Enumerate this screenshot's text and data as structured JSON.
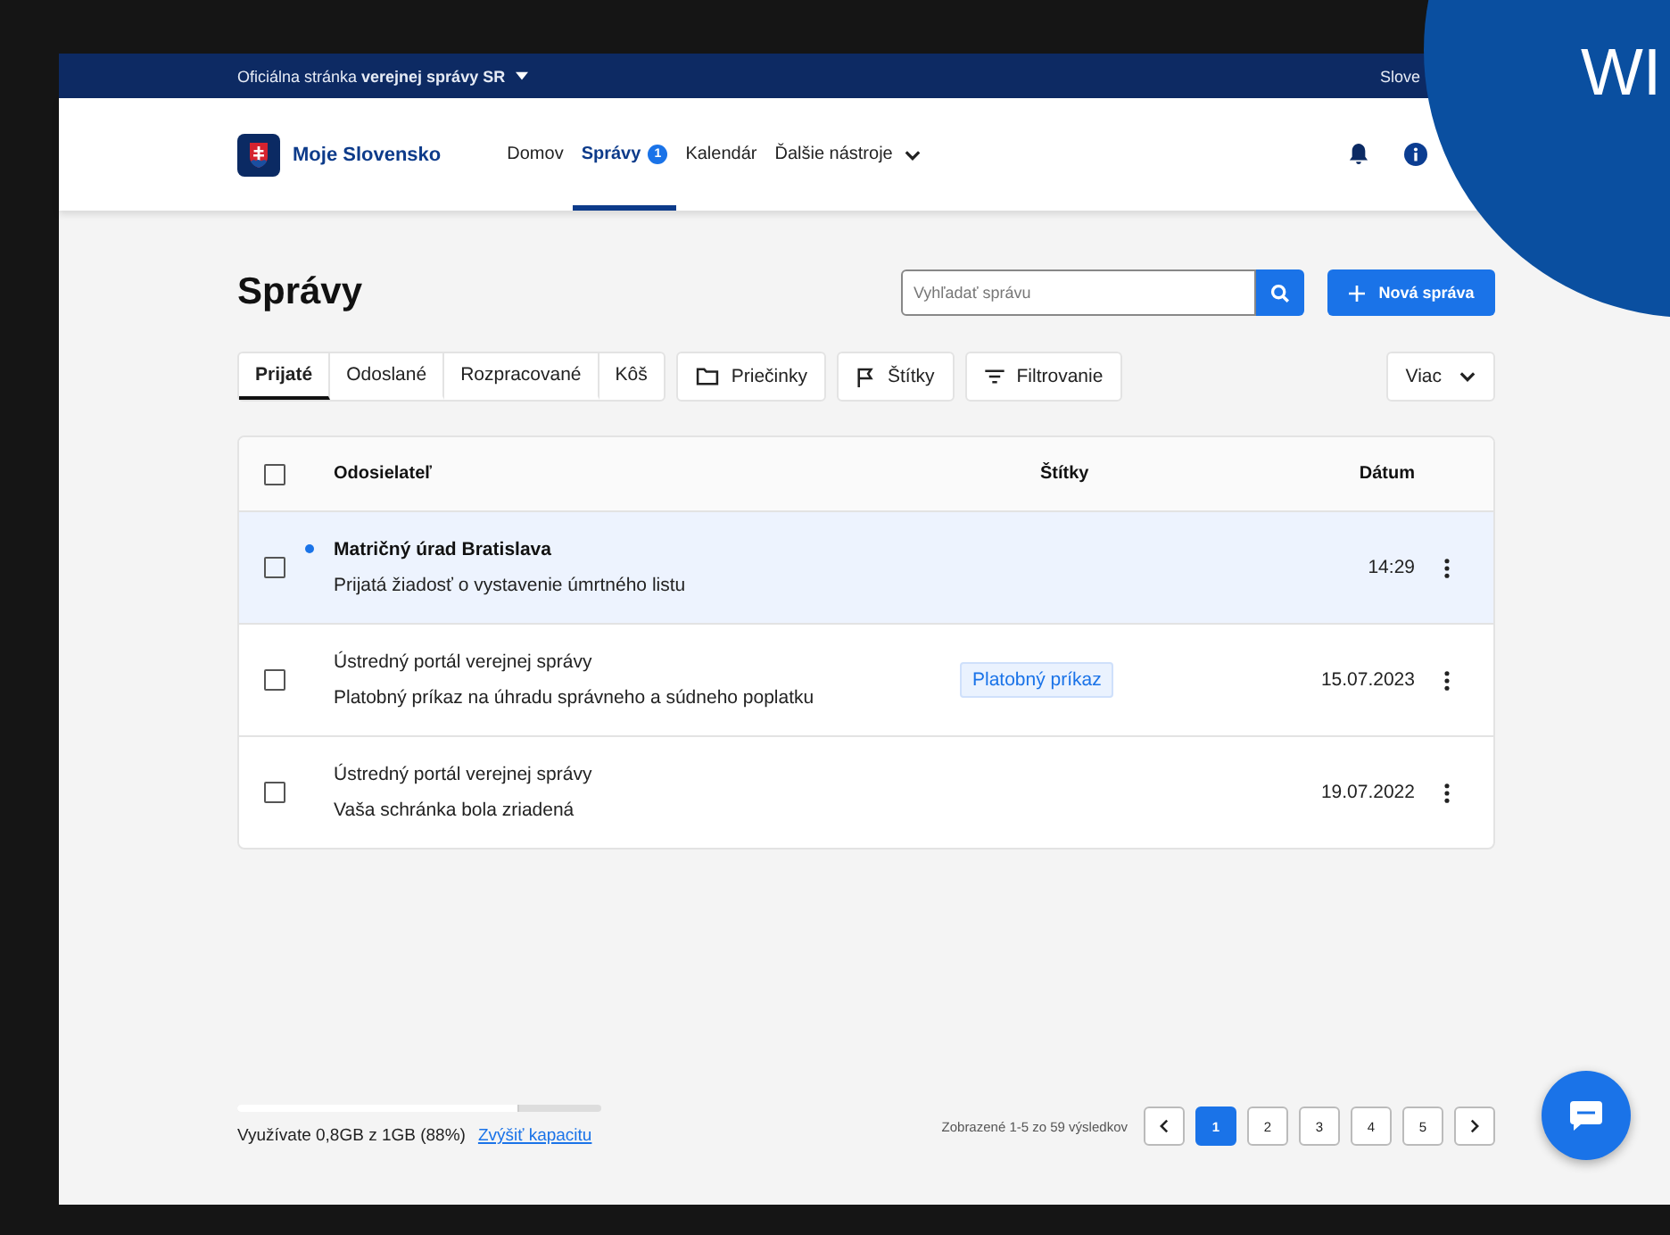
{
  "top_bar": {
    "text": "Oficiálna stránka **verejnej správy SR**",
    "language": "Slove"
  },
  "overlay_badge": {
    "text": "WI"
  },
  "header": {
    "logo_text": "Moje Slovensko",
    "nav": [
      {
        "label": "Domov",
        "selected": false
      },
      {
        "label": "Správy",
        "selected": true,
        "badge": "1"
      },
      {
        "label": "Kalendár",
        "selected": false
      },
      {
        "label": "Ďalšie nástroje",
        "selected": false,
        "dropdown": true
      }
    ]
  },
  "page": {
    "title": "Správy",
    "search": {
      "placeholder": "Vyhľadať správu"
    },
    "new_button": "Nová správa"
  },
  "tabs": [
    {
      "label": "Prijaté",
      "selected": true
    },
    {
      "label": "Odoslané",
      "selected": false
    },
    {
      "label": "Rozpracované",
      "selected": false
    },
    {
      "label": "Kôš",
      "selected": false
    }
  ],
  "tools": [
    {
      "label": "Priečinky",
      "kind": "folder"
    },
    {
      "label": "Štítky",
      "kind": "flag"
    },
    {
      "label": "Filtrovanie",
      "kind": "filter"
    }
  ],
  "more_button": "Viac",
  "table": {
    "columns": [
      "Odosielateľ",
      "Štítky",
      "Dátum"
    ],
    "header_checked": false,
    "rows": [
      {
        "sender": "Matričný úrad Bratislava",
        "subject": "Prijatá žiadosť o vystavenie úmrtného listu",
        "unread": true,
        "date": "14:29",
        "checked": false
      },
      {
        "sender": "Ústredný portál verejnej správy",
        "subject": "Platobný príkaz na úhradu správneho a súdneho poplatku",
        "unread": false,
        "tag": "Platobný príkaz",
        "date": "15.07.2023",
        "checked": false
      },
      {
        "sender": "Ústredný portál verejnej správy",
        "subject": "Vaša schránka bola zriadená",
        "unread": false,
        "date": "19.07.2022",
        "checked": false
      }
    ]
  },
  "storage": {
    "level": 0.77,
    "text": "Využívate 0,8GB z 1GB (88%)",
    "link": "Zvýšiť kapacitu"
  },
  "pagination": {
    "summary": "Zobrazené 1-5 zo 59 výsledkov",
    "pages": [
      {
        "label": "1",
        "selected": true
      },
      {
        "label": "2",
        "selected": false
      },
      {
        "label": "3",
        "selected": false
      },
      {
        "label": "4",
        "selected": false
      },
      {
        "label": "5",
        "selected": false
      }
    ]
  }
}
